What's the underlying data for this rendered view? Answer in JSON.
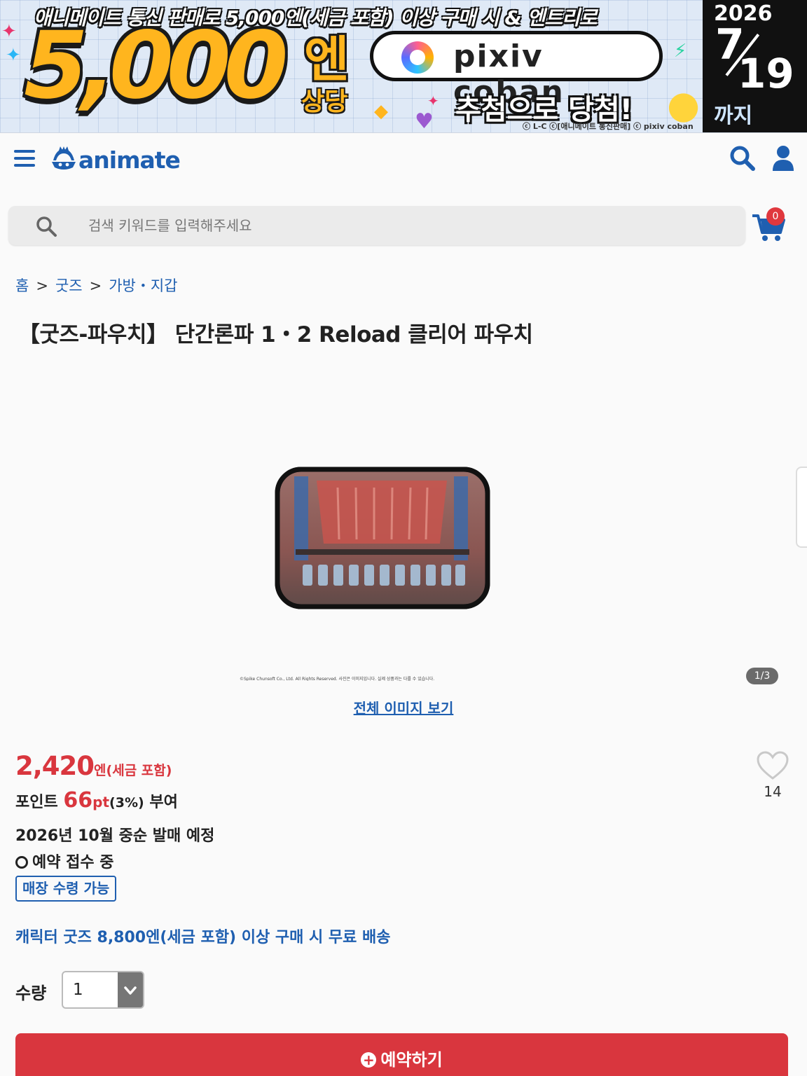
{
  "banner": {
    "headline": "애니메이트 통신 판매로 5,000엔(세금 포함) 이상 구매 시 & 엔트리로",
    "amount": "5,000",
    "amount_unit": "엔",
    "equivalent": "상당",
    "brand": "pixiv coban",
    "lottery": "추첨으로 당첨!",
    "copyright": "ⓒ L-C ⓒ[애니메이트 통신판매] ⓒ pixiv coban",
    "year": "2026",
    "month": "7",
    "day": "19",
    "until": "까지"
  },
  "header": {
    "logo": "animate"
  },
  "search": {
    "placeholder": "검색 키워드를 입력해주세요"
  },
  "cart": {
    "count": "0"
  },
  "breadcrumb": [
    "홈",
    "굿즈",
    "가방・지갑"
  ],
  "product": {
    "title": "【굿즈-파우치】 단간론파 1・2 Reload 클리어 파우치",
    "image_caption": "©Spike Chunsoft Co., Ltd. All Rights Reserved. 사진은 이미지입니다. 실제 상품과는 다를 수 있습니다.",
    "image_counter": "1/3",
    "view_all": "전체 이미지 보기",
    "price": "2,420",
    "price_unit": "엔(세금 포함)",
    "points_prefix": "포인트",
    "points_value": "66",
    "points_unit": "pt",
    "points_rate": "(3%)",
    "points_suffix": " 부여",
    "release": "2026년 10월 중순 발매 예정",
    "reservation": "예약 접수 중",
    "store_pickup": "매장 수령 가능",
    "shipping_note": "캐릭터 굿즈 8,800엔(세금 포함) 이상 구매 시 무료 배송",
    "favorites": "14",
    "quantity_label": "수량",
    "quantity": "1",
    "reserve_button": "예약하기"
  },
  "colors": {
    "brand_blue": "#1f5fb0",
    "price_red": "#d9363e",
    "button_red": "#d9363e"
  }
}
